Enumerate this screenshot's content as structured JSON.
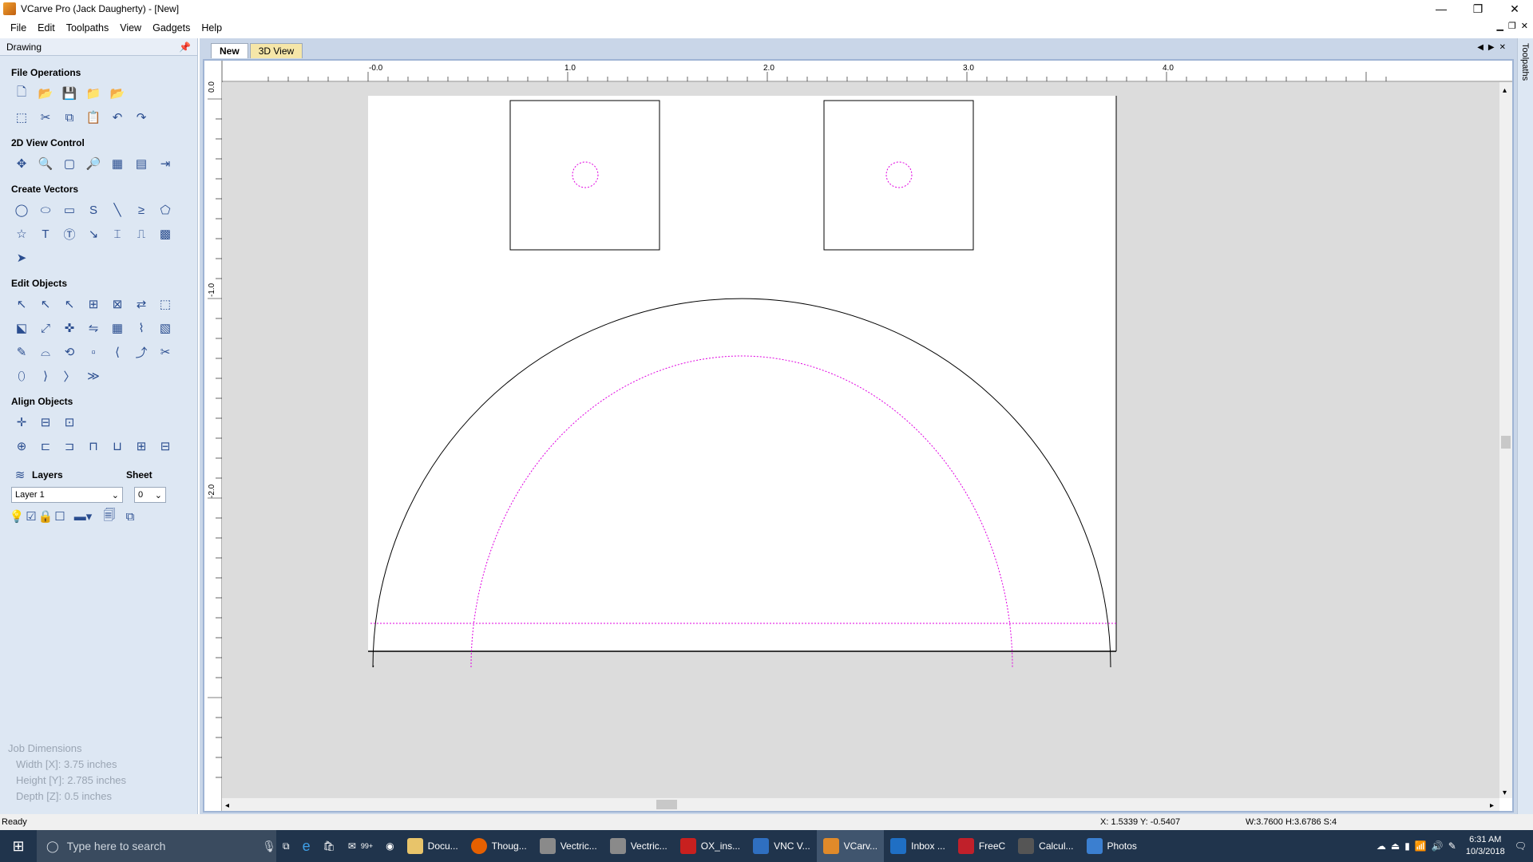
{
  "window": {
    "title": "VCarve Pro (Jack Daugherty) - [New]"
  },
  "menu": [
    "File",
    "Edit",
    "Toolpaths",
    "View",
    "Gadgets",
    "Help"
  ],
  "sidebar": {
    "header": "Drawing",
    "sections": {
      "file_ops": "File Operations",
      "view_control": "2D View Control",
      "create_vectors": "Create Vectors",
      "edit_objects": "Edit Objects",
      "align_objects": "Align Objects"
    },
    "layers_label": "Layers",
    "sheet_label": "Sheet",
    "layer_value": "Layer 1",
    "sheet_value": "0"
  },
  "job": {
    "title": "Job Dimensions",
    "width": "Width  [X]: 3.75 inches",
    "height": "Height [Y]: 2.785 inches",
    "depth": "Depth  [Z]: 0.5 inches"
  },
  "tabs": [
    "New",
    "3D View"
  ],
  "right_toolbar": "Toolpaths",
  "ruler": {
    "top": [
      "-0.0",
      "1.0",
      "2.0",
      "3.0",
      "4.0"
    ],
    "left": [
      "0.0",
      "-1.0",
      "-2.0"
    ]
  },
  "status": {
    "left": "Ready",
    "coords": "X: 1.5339 Y: -0.5407",
    "dims": "W:3.7600  H:3.6786  S:4"
  },
  "taskbar": {
    "search": "Type here to search",
    "items": [
      "Docu...",
      "Thoug...",
      "Vectric...",
      "Vectric...",
      "OX_ins...",
      "VNC V...",
      "VCarv...",
      "Inbox ...",
      "FreeC",
      "Calcul...",
      "Photos"
    ],
    "badge": "99+",
    "time": "6:31 AM",
    "date": "10/3/2018"
  },
  "colors": {
    "sidebar": "#dde7f3",
    "vector": "#000000",
    "toolpath": "#e000e0",
    "taskbar": "#20344c"
  }
}
